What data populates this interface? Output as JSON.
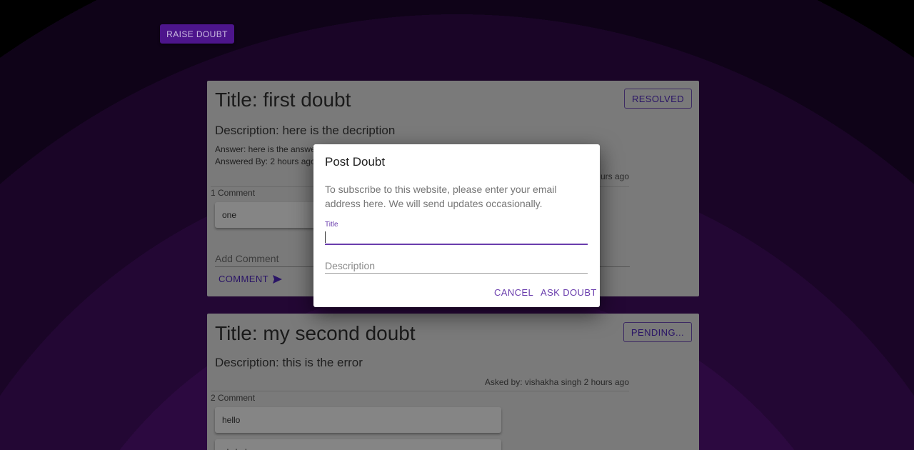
{
  "app": {
    "raise_button": "RAISE DOUBT"
  },
  "doubts": [
    {
      "title": "Title: first doubt",
      "description": "Description: here is the decription",
      "status": "RESOLVED",
      "answer": "Answer: here is the answe",
      "answered_by": "Answered By: 2 hours ago",
      "asked_meta": "urs ago",
      "comment_count": "1 Comment",
      "comments": [
        "one"
      ],
      "add_comment_placeholder": "Add Comment",
      "comment_button": "COMMENT"
    },
    {
      "title": "Title: my second doubt",
      "description": "Description: this is the error",
      "status": "PENDING...",
      "asked_meta": "Asked by: vishakha singh 2 hours ago",
      "comment_count": "2 Comment",
      "comments": [
        "hello",
        "plz help"
      ]
    }
  ],
  "dialog": {
    "title": "Post Doubt",
    "text": "To subscribe to this website, please enter your email address here. We will send updates occasionally.",
    "title_label": "Title",
    "description_placeholder": "Description",
    "cancel": "CANCEL",
    "submit": "ASK DOUBT"
  },
  "colors": {
    "accent": "#6a3dad",
    "raise_button_bg": "#4d158c"
  }
}
